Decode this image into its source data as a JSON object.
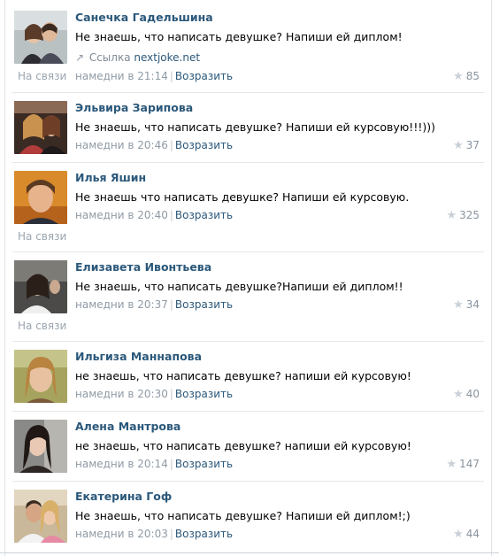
{
  "comments": [
    {
      "author": "Санечка Гадельшина",
      "text": "Не знаешь, что написать девушке? Напиши ей диплом!",
      "link_label": "Ссылка",
      "link_url": "nextjoke.net",
      "online": "На связи",
      "time": "намедни в 21:14",
      "reply": "Возразить",
      "likes": "85"
    },
    {
      "author": "Эльвира Зарипова",
      "text": "Не знаешь, что написать девушке? Напиши ей курсовую!!!)))",
      "time": "намедни в 20:46",
      "reply": "Возразить",
      "likes": "37"
    },
    {
      "author": "Илья Яшин",
      "text": "Не знаешь что написать девушке? Напиши ей курсовую.",
      "online": "На связи",
      "time": "намедни в 20:40",
      "reply": "Возразить",
      "likes": "325"
    },
    {
      "author": "Елизавета Ивонтьева",
      "text": "Не знаешь, что написать девушке?Напиши ей диплом!!",
      "online": "На связи",
      "time": "намедни в 20:37",
      "reply": "Возразить",
      "likes": "34"
    },
    {
      "author": "Ильгиза Маннапова",
      "text": "не знаешь, что написать девушке? напиши ей курсовую!",
      "time": "намедни в 20:30",
      "reply": "Возразить",
      "likes": "40"
    },
    {
      "author": "Алена Мантрова",
      "text": "не знаешь, что написать девушке? напиши ей курсовую!",
      "time": "намедни в 20:14",
      "reply": "Возразить",
      "likes": "147"
    },
    {
      "author": "Екатерина Гоф",
      "text": "Не знаешь, что написать девушке? Напиши ей диплом!;)",
      "time": "намедни в 20:03",
      "reply": "Возразить",
      "likes": "44"
    }
  ],
  "colors": {
    "author": "#2b587a",
    "muted": "#8f9aa5",
    "divider": "#e3e7eb"
  }
}
